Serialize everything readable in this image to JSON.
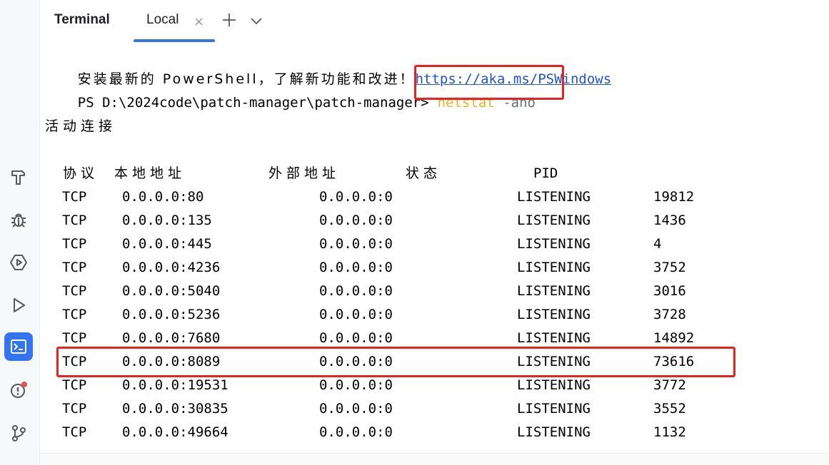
{
  "header": {
    "tool_title": "Terminal",
    "tab_label": "Local",
    "tab_close": "×"
  },
  "terminal": {
    "promo_text": "安装最新的 PowerShell，了解新功能和改进！",
    "promo_link": "https://aka.ms/PSWindows",
    "prompt": "PS D:\\2024code\\patch-manager\\patch-manager>",
    "command": "netstat",
    "command_args": "-ano",
    "section_title": "活动连接",
    "columns": [
      "协议",
      "本地地址",
      "外部地址",
      "状态",
      "PID"
    ],
    "rows": [
      {
        "proto": "TCP",
        "local": "0.0.0.0:80",
        "foreign": "0.0.0.0:0",
        "state": "LISTENING",
        "pid": "19812"
      },
      {
        "proto": "TCP",
        "local": "0.0.0.0:135",
        "foreign": "0.0.0.0:0",
        "state": "LISTENING",
        "pid": "1436"
      },
      {
        "proto": "TCP",
        "local": "0.0.0.0:445",
        "foreign": "0.0.0.0:0",
        "state": "LISTENING",
        "pid": "4"
      },
      {
        "proto": "TCP",
        "local": "0.0.0.0:4236",
        "foreign": "0.0.0.0:0",
        "state": "LISTENING",
        "pid": "3752"
      },
      {
        "proto": "TCP",
        "local": "0.0.0.0:5040",
        "foreign": "0.0.0.0:0",
        "state": "LISTENING",
        "pid": "3016"
      },
      {
        "proto": "TCP",
        "local": "0.0.0.0:5236",
        "foreign": "0.0.0.0:0",
        "state": "LISTENING",
        "pid": "3728"
      },
      {
        "proto": "TCP",
        "local": "0.0.0.0:7680",
        "foreign": "0.0.0.0:0",
        "state": "LISTENING",
        "pid": "14892"
      },
      {
        "proto": "TCP",
        "local": "0.0.0.0:8089",
        "foreign": "0.0.0.0:0",
        "state": "LISTENING",
        "pid": "73616"
      },
      {
        "proto": "TCP",
        "local": "0.0.0.0:19531",
        "foreign": "0.0.0.0:0",
        "state": "LISTENING",
        "pid": "3772"
      },
      {
        "proto": "TCP",
        "local": "0.0.0.0:30835",
        "foreign": "0.0.0.0:0",
        "state": "LISTENING",
        "pid": "3552"
      },
      {
        "proto": "TCP",
        "local": "0.0.0.0:49664",
        "foreign": "0.0.0.0:0",
        "state": "LISTENING",
        "pid": "1132"
      }
    ]
  },
  "sidebar": {
    "tools": [
      {
        "icon": "hammer-icon"
      },
      {
        "icon": "bug-icon"
      },
      {
        "icon": "services-icon"
      },
      {
        "icon": "run-icon"
      },
      {
        "icon": "terminal-icon",
        "active": true
      },
      {
        "icon": "problems-icon"
      },
      {
        "icon": "git-icon"
      }
    ]
  },
  "colors": {
    "accent": "#3574f0",
    "highlight_box": "#e8221f",
    "command": "#e0b52b",
    "link": "#2154cc",
    "notification_dot": "#e55353"
  }
}
